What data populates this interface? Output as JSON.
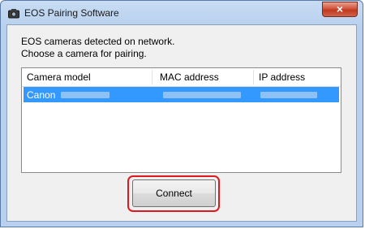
{
  "window": {
    "title": "EOS Pairing Software",
    "close_label": "×"
  },
  "message": {
    "line1": "EOS cameras detected on network.",
    "line2": "Choose a camera for pairing."
  },
  "table": {
    "columns": [
      "Camera model",
      "MAC address",
      "IP address"
    ],
    "rows": [
      {
        "model": "Canon"
      }
    ]
  },
  "buttons": {
    "connect": "Connect"
  },
  "colors": {
    "selection": "#3399ff",
    "highlight_ring": "#e0191f"
  }
}
